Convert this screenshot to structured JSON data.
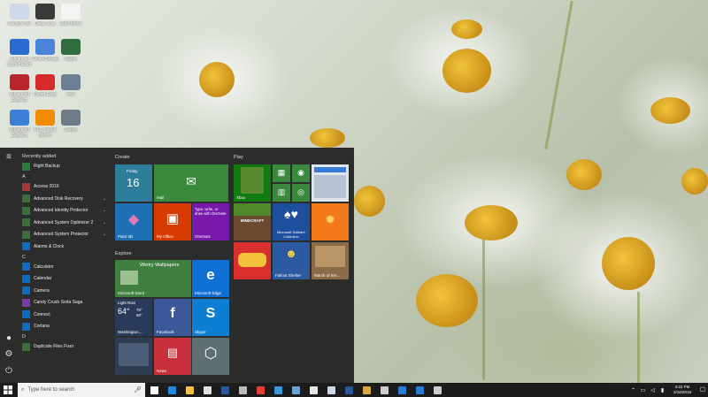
{
  "desktop": {
    "icons": [
      {
        "label": "Recycle Bin",
        "color": "#cfd8e6"
      },
      {
        "label": "Daily Scan",
        "color": "#3a3a3a"
      },
      {
        "label": "Start Menu",
        "color": "#f4f4f4"
      },
      {
        "label": "Advanced SystemCare",
        "color": "#2a6ad1"
      },
      {
        "label": "Smart Defrag",
        "color": "#4a84d8"
      },
      {
        "label": "Game",
        "color": "#2f6e3c"
      },
      {
        "label": "Advanced System Protector",
        "color": "#b8262c"
      },
      {
        "label": "Driver Easy",
        "color": "#d72b2b"
      },
      {
        "label": "Intel",
        "color": "#6d7f92"
      },
      {
        "label": "Advanced System Optimizer",
        "color": "#3d7fd4"
      },
      {
        "label": "VLC media player",
        "color": "#f18b00"
      },
      {
        "label": "Steam",
        "color": "#6f7b86"
      }
    ]
  },
  "start_menu": {
    "recently_added_label": "Recently added",
    "sections": [
      {
        "letter": "",
        "apps": [
          {
            "name": "Right Backup",
            "icon_color": "#2c7a3a",
            "expand": false
          }
        ]
      },
      {
        "letter": "A",
        "apps": [
          {
            "name": "Access 2016",
            "icon_color": "#a4373a",
            "expand": false
          },
          {
            "name": "Advanced Disk Recovery",
            "icon_color": "#3a6f3a",
            "expand": true
          },
          {
            "name": "Advanced Identity Protector",
            "icon_color": "#3a6f3a",
            "expand": true
          },
          {
            "name": "Advanced System Optimizer 2",
            "icon_color": "#3a6f3a",
            "expand": true
          },
          {
            "name": "Advanced System Protector",
            "icon_color": "#3a6f3a",
            "expand": true
          },
          {
            "name": "Alarms & Clock",
            "icon_color": "#0b6cc0",
            "expand": false
          }
        ]
      },
      {
        "letter": "C",
        "apps": [
          {
            "name": "Calculator",
            "icon_color": "#0b6cc0",
            "expand": false
          },
          {
            "name": "Calendar",
            "icon_color": "#0b6cc0",
            "expand": false
          },
          {
            "name": "Camera",
            "icon_color": "#0b6cc0",
            "expand": false
          },
          {
            "name": "Candy Crush Soda Saga",
            "icon_color": "#7a3aa8",
            "expand": false
          },
          {
            "name": "Connect",
            "icon_color": "#0b6cc0",
            "expand": false
          },
          {
            "name": "Cortana",
            "icon_color": "#0b6cc0",
            "expand": false
          }
        ]
      },
      {
        "letter": "D",
        "apps": [
          {
            "name": "Duplicate Files Fixer",
            "icon_color": "#3a6f3a",
            "expand": false
          }
        ]
      }
    ],
    "groups": {
      "create": "Create",
      "play": "Play",
      "explore": "Explore"
    },
    "tiles": {
      "calendar_day": "Friday",
      "calendar_date": "16",
      "mail": "Mail",
      "paint3d": "Paint 3D",
      "myoffice": "My Office",
      "onenote_text": "Type, write, or draw with OneNote",
      "onenote": "OneNote",
      "xbox": "Xbox",
      "minecraft": "MINECRAFT",
      "solitaire": "Microsoft Solitaire Collection",
      "fallout": "Fallout Shelter",
      "march": "March of Em...",
      "store_text": "Wintry Wallpapers",
      "store": "Microsoft Store",
      "edge": "Microsoft Edge",
      "weather_cond": "Light Rain",
      "weather_temp": "64°",
      "weather_hi": "70°",
      "weather_lo": "60°",
      "weather_city": "Washington,...",
      "facebook": "Facebook",
      "skype": "Skype",
      "news": "News"
    }
  },
  "taskbar": {
    "search_placeholder": "Type here to search",
    "time": "4:22 PM",
    "date": "2/16/2018",
    "apps": [
      {
        "name": "task-view",
        "color": "#ffffff"
      },
      {
        "name": "edge",
        "color": "#1f8ae0"
      },
      {
        "name": "file-explorer",
        "color": "#f3c14b"
      },
      {
        "name": "store",
        "color": "#e0e0e0"
      },
      {
        "name": "word",
        "color": "#2b5797"
      },
      {
        "name": "settings",
        "color": "#bbbbbb"
      },
      {
        "name": "chrome",
        "color": "#e44134"
      },
      {
        "name": "ie",
        "color": "#3a9ad9"
      },
      {
        "name": "photos",
        "color": "#6aa2d6"
      },
      {
        "name": "mail",
        "color": "#e6e6e6"
      },
      {
        "name": "excel-like",
        "color": "#cfd8e6"
      },
      {
        "name": "word2",
        "color": "#2b5797"
      },
      {
        "name": "explorer2",
        "color": "#d6a640"
      },
      {
        "name": "calculator",
        "color": "#cccccc"
      },
      {
        "name": "app-a",
        "color": "#2e7bd6"
      },
      {
        "name": "app-b",
        "color": "#2e7bd6"
      },
      {
        "name": "gear",
        "color": "#cccccc"
      }
    ]
  }
}
